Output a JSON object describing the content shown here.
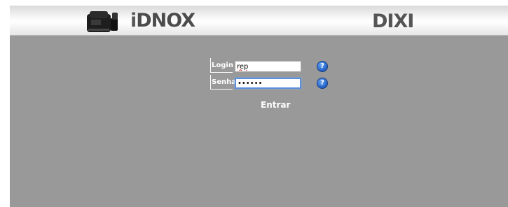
{
  "header": {
    "device_icon": "fingerprint-time-clock-device-icon",
    "brand_left": {
      "initial": "i",
      "rest": "DNOX"
    },
    "brand_right": "DIXI"
  },
  "form": {
    "login_label": "Login",
    "login_value": "rep",
    "password_label": "Senha",
    "password_value": "••••••",
    "help_icon": "help-question-icon",
    "help_glyph": "?",
    "submit_label": "Entrar"
  },
  "colors": {
    "background": "#999999",
    "header_gradient": [
      "#d9d9d9",
      "#ffffff",
      "#e6e6e6"
    ],
    "help_icon": "#1f5fc6",
    "focus_ring": "#5b8fd9"
  }
}
